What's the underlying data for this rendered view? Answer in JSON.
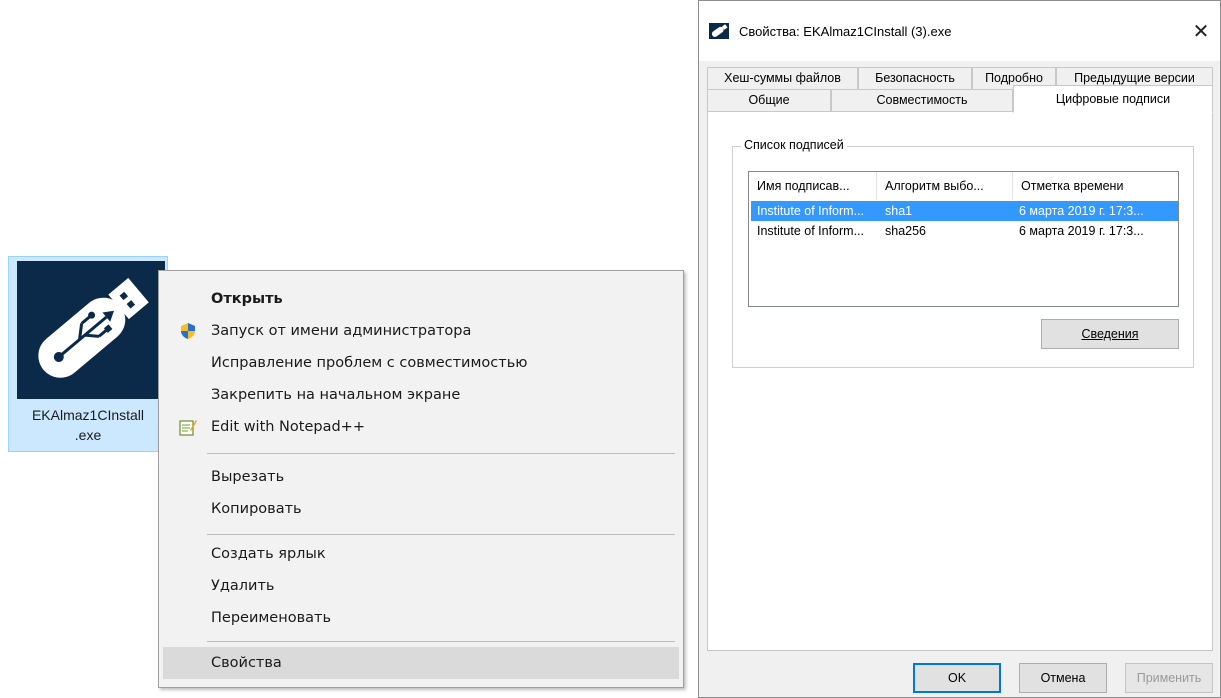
{
  "desktop": {
    "file_label_line1": "EKAlmaz1CInstall",
    "file_label_line2": ".exe",
    "icon": "usb-flash-drive-icon"
  },
  "context_menu": {
    "items": [
      {
        "label": "Открыть",
        "bold": true
      },
      {
        "label": "Запуск от имени администратора",
        "icon": "uac-shield-icon"
      },
      {
        "label": "Исправление проблем с совместимостью"
      },
      {
        "label": "Закрепить на начальном экране"
      },
      {
        "label": "Edit with Notepad++",
        "icon": "notepad-plus-plus-icon"
      },
      {
        "label": "Вырезать"
      },
      {
        "label": "Копировать"
      },
      {
        "label": "Создать ярлык"
      },
      {
        "label": "Удалить"
      },
      {
        "label": "Переименовать"
      },
      {
        "label": "Свойства",
        "highlighted": true
      }
    ]
  },
  "dialog": {
    "title": "Свойства: EKAlmaz1CInstall (3).exe",
    "close_glyph": "✕",
    "tabs_row1": [
      "Хеш-суммы файлов",
      "Безопасность",
      "Подробно",
      "Предыдущие версии"
    ],
    "tabs_row2": [
      "Общие",
      "Совместимость",
      "Цифровые подписи"
    ],
    "active_tab": "Цифровые подписи",
    "group_title": "Список подписей",
    "columns": [
      "Имя подписав...",
      "Алгоритм выбо...",
      "Отметка времени"
    ],
    "rows": [
      {
        "signer": "Institute of Inform...",
        "algorithm": "sha1",
        "timestamp": "6 марта 2019 г. 17:3...",
        "selected": true
      },
      {
        "signer": "Institute of Inform...",
        "algorithm": "sha256",
        "timestamp": "6 марта 2019 г. 17:3...",
        "selected": false
      }
    ],
    "details_button": "Сведения",
    "ok_button": "OK",
    "cancel_button": "Отмена",
    "apply_button": "Применить"
  },
  "colors": {
    "selection": "#3399ff",
    "icon_selection": "#cce8ff",
    "menu_background": "#f2f2f2",
    "drive_background": "#0b2a4a"
  }
}
